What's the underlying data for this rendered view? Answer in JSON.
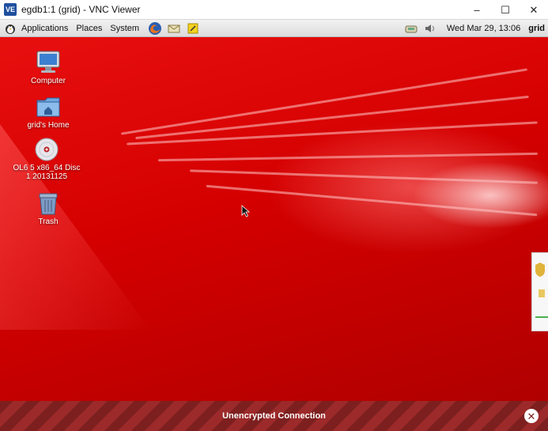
{
  "window": {
    "title": "egdb1:1 (grid) - VNC Viewer",
    "logo_text": "VE",
    "controls": {
      "minimize": "–",
      "maximize": "☐",
      "close": "✕"
    }
  },
  "panel": {
    "menus": [
      "Applications",
      "Places",
      "System"
    ],
    "clock": "Wed Mar 29, 13:06",
    "user": "grid"
  },
  "desktop": {
    "icons": [
      {
        "label": "Computer",
        "icon": "computer-icon"
      },
      {
        "label": "grid's Home",
        "icon": "home-folder-icon"
      },
      {
        "label": "OL6 5 x86_64 Disc 1 20131125",
        "icon": "dvd-disc-icon"
      },
      {
        "label": "Trash",
        "icon": "trash-icon"
      }
    ]
  },
  "connection_bar": {
    "text": "Unencrypted Connection",
    "close": "✕"
  },
  "colors": {
    "desktop_red": "#d40000",
    "connection_bar": "#7d1f1f"
  }
}
